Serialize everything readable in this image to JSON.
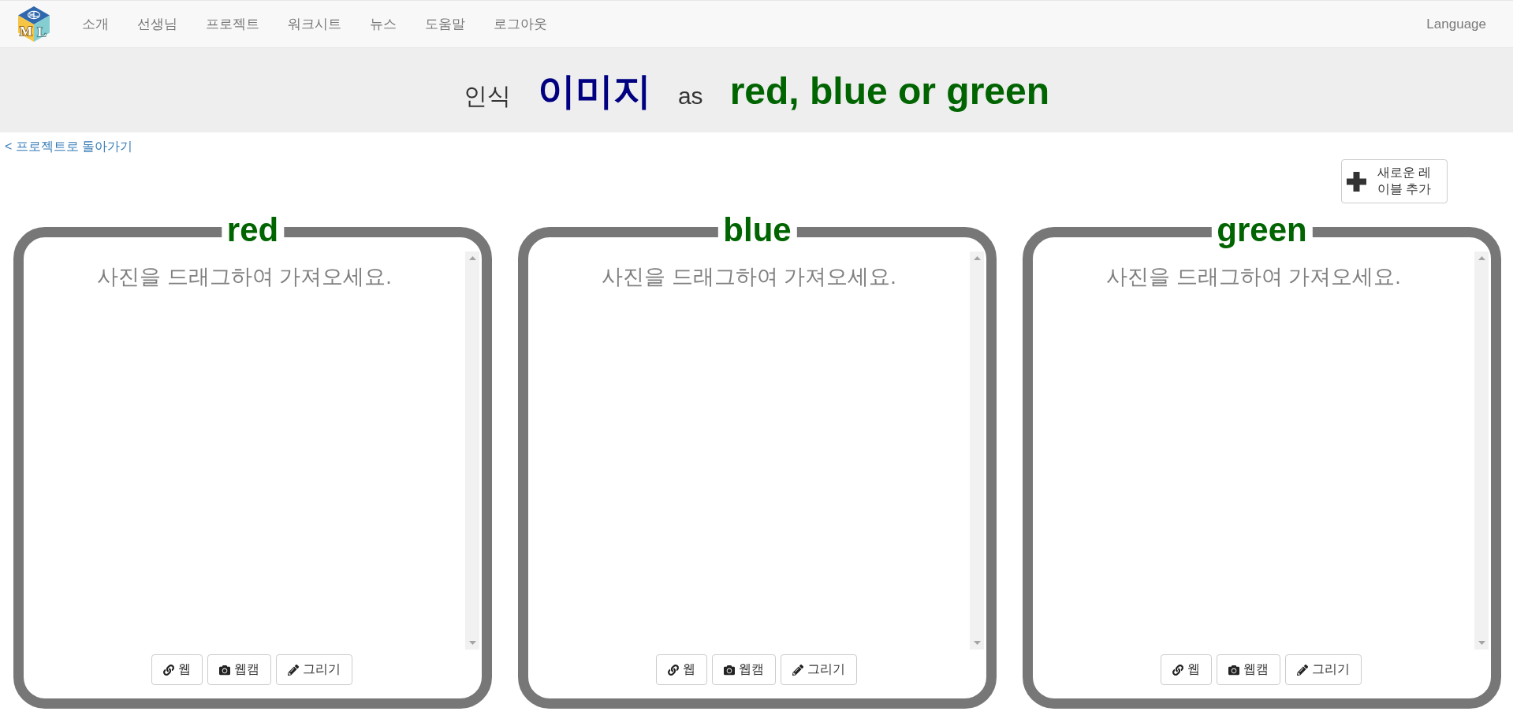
{
  "navbar": {
    "logo": {
      "letters": [
        "M",
        "L"
      ]
    },
    "items": [
      "소개",
      "선생님",
      "프로젝트",
      "워크시트",
      "뉴스",
      "도움말",
      "로그아웃"
    ],
    "language": "Language"
  },
  "banner": {
    "parts": [
      {
        "kind": "plain",
        "text": "인식"
      },
      {
        "kind": "type",
        "text": "이미지"
      },
      {
        "kind": "plain",
        "text": "as"
      },
      {
        "kind": "labels",
        "text": "red, blue or green"
      }
    ]
  },
  "back_link": "< 프로젝트로 돌아가기",
  "add_label_button": "새로운 레이블 추가",
  "label_cards": [
    {
      "label": "red",
      "hint": "사진을 드래그하여 가져오세요.",
      "buttons": [
        {
          "kind": "web",
          "label": "웹"
        },
        {
          "kind": "webcam",
          "label": "웹캠"
        },
        {
          "kind": "draw",
          "label": "그리기"
        }
      ]
    },
    {
      "label": "blue",
      "hint": "사진을 드래그하여 가져오세요.",
      "buttons": [
        {
          "kind": "web",
          "label": "웹"
        },
        {
          "kind": "webcam",
          "label": "웹캠"
        },
        {
          "kind": "draw",
          "label": "그리기"
        }
      ]
    },
    {
      "label": "green",
      "hint": "사진을 드래그하여 가져오세요.",
      "buttons": [
        {
          "kind": "web",
          "label": "웹"
        },
        {
          "kind": "webcam",
          "label": "웹캠"
        },
        {
          "kind": "draw",
          "label": "그리기"
        }
      ]
    }
  ]
}
